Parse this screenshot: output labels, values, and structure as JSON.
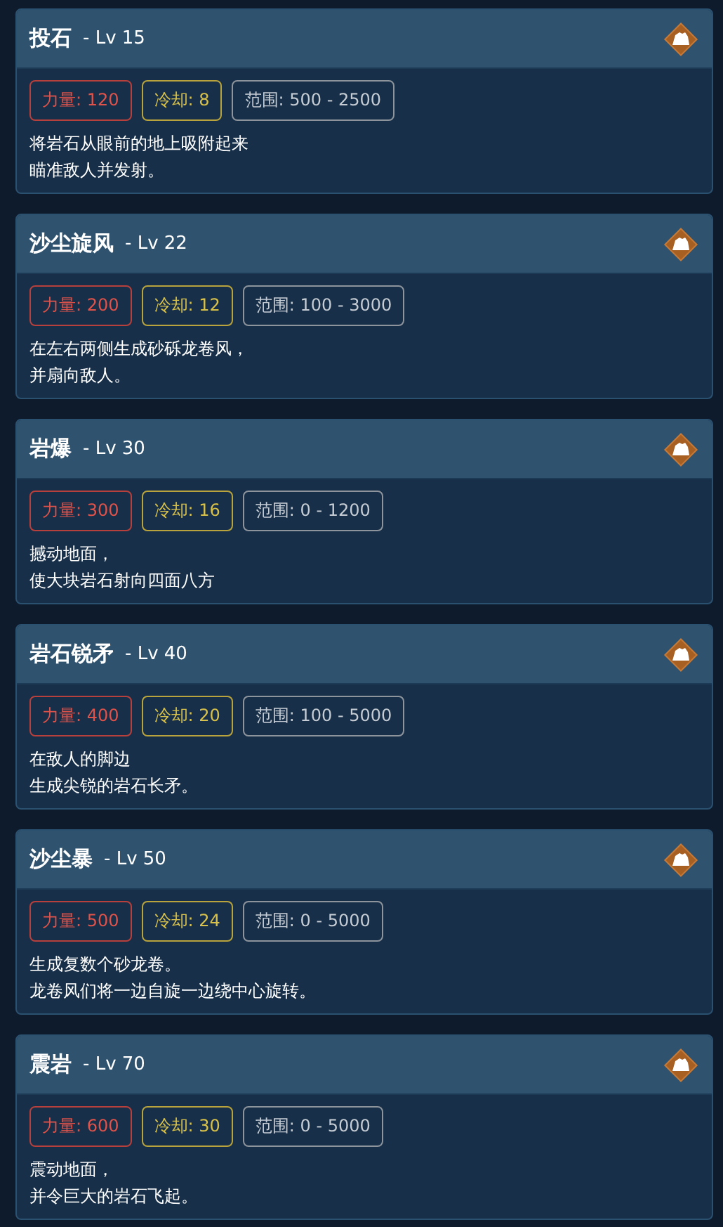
{
  "skills": [
    {
      "name": "投石",
      "level": "- Lv 15",
      "stats": [
        {
          "kind": "power",
          "text": "力量: 120"
        },
        {
          "kind": "cooldown",
          "text": "冷却: 8"
        },
        {
          "kind": "range",
          "text": "范围: 500 - 2500"
        }
      ],
      "description": [
        "将岩石从眼前的地上吸附起来",
        "瞄准敌人并发射。"
      ]
    },
    {
      "name": "沙尘旋风",
      "level": "- Lv 22",
      "stats": [
        {
          "kind": "power",
          "text": "力量: 200"
        },
        {
          "kind": "cooldown",
          "text": "冷却: 12"
        },
        {
          "kind": "range",
          "text": "范围: 100 - 3000"
        }
      ],
      "description": [
        "在左右两侧生成砂砾龙卷风，",
        "并扇向敌人。"
      ]
    },
    {
      "name": "岩爆",
      "level": "- Lv 30",
      "stats": [
        {
          "kind": "power",
          "text": "力量: 300"
        },
        {
          "kind": "cooldown",
          "text": "冷却: 16"
        },
        {
          "kind": "range",
          "text": "范围: 0 - 1200"
        }
      ],
      "description": [
        "撼动地面，",
        "使大块岩石射向四面八方"
      ]
    },
    {
      "name": "岩石锐矛",
      "level": "- Lv 40",
      "stats": [
        {
          "kind": "power",
          "text": "力量: 400"
        },
        {
          "kind": "cooldown",
          "text": "冷却: 20"
        },
        {
          "kind": "range",
          "text": "范围: 100 - 5000"
        }
      ],
      "description": [
        "在敌人的脚边",
        "生成尖锐的岩石长矛。"
      ]
    },
    {
      "name": "沙尘暴",
      "level": "- Lv 50",
      "stats": [
        {
          "kind": "power",
          "text": "力量: 500"
        },
        {
          "kind": "cooldown",
          "text": "冷却: 24"
        },
        {
          "kind": "range",
          "text": "范围: 0 - 5000"
        }
      ],
      "description": [
        "生成复数个砂龙卷。",
        "龙卷风们将一边自旋一边绕中心旋转。"
      ]
    },
    {
      "name": "震岩",
      "level": "- Lv 70",
      "stats": [
        {
          "kind": "power",
          "text": "力量: 600"
        },
        {
          "kind": "cooldown",
          "text": "冷却: 30"
        },
        {
          "kind": "range",
          "text": "范围: 0 - 5000"
        }
      ],
      "description": [
        "震动地面，",
        "并令巨大的岩石飞起。"
      ]
    }
  ]
}
